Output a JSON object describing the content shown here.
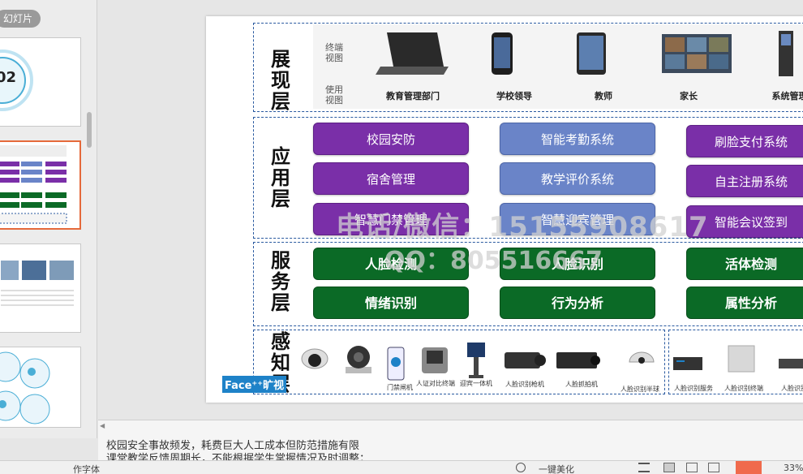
{
  "left_panel": {
    "tab_label": "幻灯片",
    "thumb1_text": "02"
  },
  "slide": {
    "layers": {
      "presentation": "展现层",
      "application": "应用层",
      "service": "服务层",
      "perception": "感知层"
    },
    "terminal_label": "终端视图",
    "usage_label": "使用视图",
    "users": [
      "教育管理部门",
      "学校领导",
      "教师",
      "家长",
      "系统管理员"
    ],
    "apps": {
      "col1": [
        "校园安防",
        "宿舍管理",
        "智慧门禁管理"
      ],
      "col2": [
        "智能考勤系统",
        "教学评价系统",
        "智慧迎宾管理"
      ],
      "col3": [
        "刷脸支付系统",
        "自主注册系统",
        "智能会议签到"
      ]
    },
    "services": {
      "row1": [
        "人脸检测",
        "人脸识别",
        "活体检测"
      ],
      "row2": [
        "情绪识别",
        "行为分析",
        "属性分析"
      ]
    },
    "sensors": [
      "门禁闸机",
      "人证对比终端",
      "迎宾一体机",
      "人脸识别枪机",
      "人脸抓拍机",
      "人脸识别半球",
      "人脸识别服务",
      "人脸识别终端",
      "人脸识别"
    ],
    "watermark_line1": "电话/微信：15155908617",
    "watermark_line2": "QQ：805516667",
    "brand": "Face⁺⁺旷视"
  },
  "notes": {
    "line1": "校园安全事故频发，耗费巨大人工成本但防范措施有限",
    "line2": "课堂教学反馈周期长，不能根据学生掌握情况及时调整；"
  },
  "status": {
    "left_text": "作字体",
    "beautify": "一键美化",
    "zoom": "33%"
  },
  "colors": {
    "purple": "#7a2fa8",
    "blue": "#6a84c8",
    "green": "#0b6a26",
    "dash": "#2a5aa0",
    "active_thumb": "#e5693a",
    "play_button": "#f06a4c"
  }
}
